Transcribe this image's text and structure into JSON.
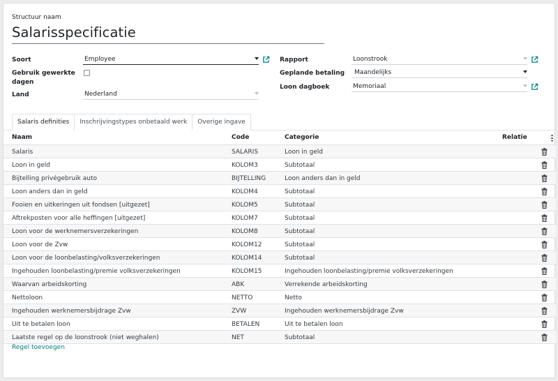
{
  "form": {
    "title_label": "Structuur naam",
    "title_value": "Salarisspecificatie",
    "left": {
      "soort_label": "Soort",
      "soort_value": "Employee",
      "gewerkte_dagen_label_1": "Gebruik gewerkte",
      "gewerkte_dagen_label_2": "dagen",
      "gewerkte_dagen_checked": false,
      "land_label": "Land",
      "land_value": "Nederland"
    },
    "right": {
      "rapport_label": "Rapport",
      "rapport_value": "Loonstrook",
      "betaling_label": "Geplande betaling",
      "betaling_value": "Maandelijks",
      "dagboek_label": "Loon dagboek",
      "dagboek_value": "Memoriaal"
    }
  },
  "tabs": [
    {
      "label": "Salaris definities",
      "active": true
    },
    {
      "label": "Inschrijvingstypes onbetaald werk",
      "active": false
    },
    {
      "label": "Overige ingave",
      "active": false
    }
  ],
  "table": {
    "columns": {
      "name": "Naam",
      "code": "Code",
      "category": "Categorie",
      "relation": "Relatie"
    },
    "rows": [
      {
        "name": "Salaris",
        "code": "SALARIS",
        "category": "Loon in geld"
      },
      {
        "name": "Loon in geld",
        "code": "KOLOM3",
        "category": "Subtotaal"
      },
      {
        "name": "Bijtelling privégebruik auto",
        "code": "BIJTELLING",
        "category": "Loon anders dan in geld"
      },
      {
        "name": "Loon anders dan in geld",
        "code": "KOLOM4",
        "category": "Subtotaal"
      },
      {
        "name": "Fooien en uitkeringen uit fondsen [uitgezet]",
        "code": "KOLOM5",
        "category": "Subtotaal"
      },
      {
        "name": "Aftrekposten voor alle heffingen [uitgezet]",
        "code": "KOLOM7",
        "category": "Subtotaal"
      },
      {
        "name": "Loon voor de werknemersverzekeringen",
        "code": "KOLOM8",
        "category": "Subtotaal"
      },
      {
        "name": "Loon voor de Zvw",
        "code": "KOLOM12",
        "category": "Subtotaal"
      },
      {
        "name": "Loon voor de loonbelasting/volksverzekeringen",
        "code": "KOLOM14",
        "category": "Subtotaal"
      },
      {
        "name": "Ingehouden loonbelasting/premie volksverzekeringen",
        "code": "KOLOM15",
        "category": "Ingehouden loonbelasting/premie volksverzekeringen"
      },
      {
        "name": "Waarvan arbeidskorting",
        "code": "ABK",
        "category": "Verrekende arbeidskorting"
      },
      {
        "name": "Nettoloon",
        "code": "NETTO",
        "category": "Netto"
      },
      {
        "name": "Ingehouden werknemersbijdrage Zvw",
        "code": "ZVW",
        "category": "Ingehouden werknemersbijdrage Zvw"
      },
      {
        "name": "Uit te betalen loon",
        "code": "BETALEN",
        "category": "Uit te betalen loon"
      },
      {
        "name": "Laatste regel op de loonstrook (niet weghalen)",
        "code": "NET",
        "category": "Subtotaal"
      }
    ],
    "add_line_label": "Regel toevoegen"
  },
  "colors": {
    "link": "#017e84",
    "text": "#212529",
    "border": "#dee2e6"
  }
}
